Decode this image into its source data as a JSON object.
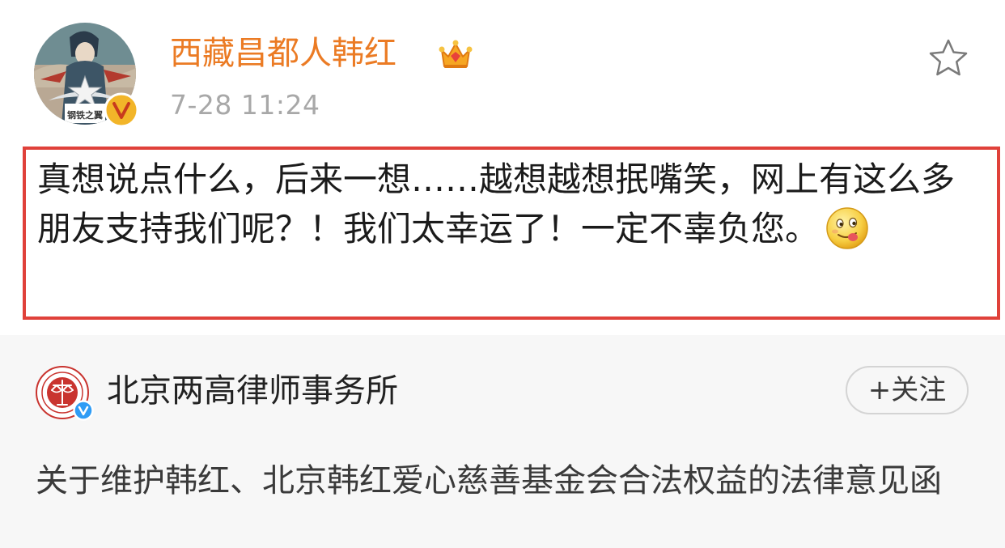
{
  "post": {
    "author": "西藏昌都人韩红",
    "time": "7-28 11:24",
    "text": "真想说点什么，后来一想……越想越想抿嘴笑，网上有这么多朋友支持我们呢？！我们太幸运了！一定不辜负您。",
    "emoji": "drooling-face-emoji",
    "avatar_caption": "钢铁之翼",
    "icons": {
      "vip": "crown-icon",
      "verified": "verified-v-icon",
      "favorite": "star-outline-icon"
    },
    "colors": {
      "author_name": "#eb7b24",
      "highlight_border": "#e0413a",
      "verified_badge": "#f2b529"
    }
  },
  "repost": {
    "author": "北京两高律师事务所",
    "follow_label": "+关注",
    "text": "关于维护韩红、北京韩红爱心慈善基金会合法权益的法律意见函",
    "icons": {
      "verified": "blue-verified-v-icon"
    },
    "colors": {
      "card_background": "#f7f7f7",
      "logo": "#c9342f",
      "verified_badge": "#2f9cf5"
    }
  }
}
